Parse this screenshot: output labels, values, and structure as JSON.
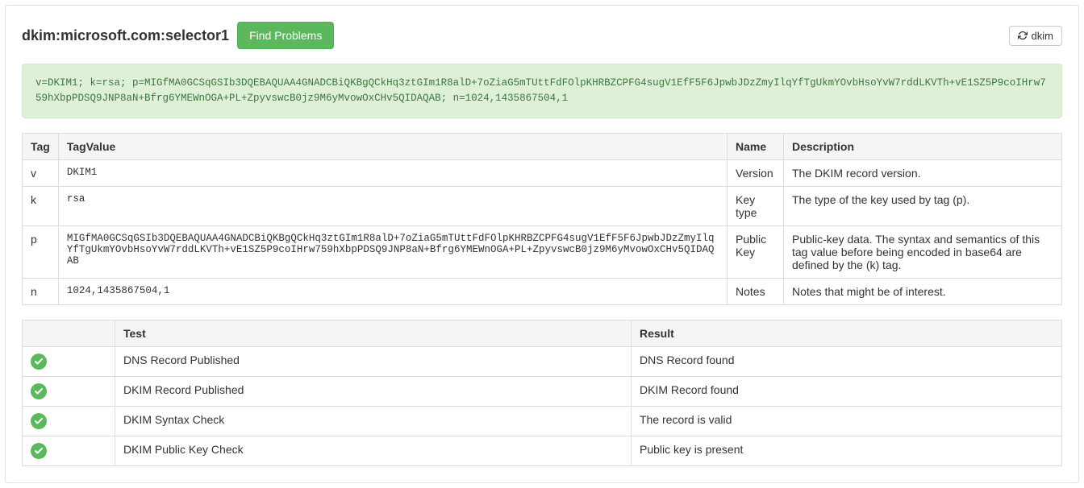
{
  "header": {
    "title": "dkim:microsoft.com:selector1",
    "find_problems_label": "Find Problems",
    "dkim_button_label": "dkim"
  },
  "record_block": "v=DKIM1; k=rsa; p=MIGfMA0GCSqGSIb3DQEBAQUAA4GNADCBiQKBgQCkHq3ztGIm1R8alD+7oZiaG5mTUttFdFOlpKHRBZCPFG4sugV1EfF5F6JpwbJDzZmyIlqYfTgUkmYOvbHsoYvW7rddLKVTh+vE1SZ5P9coIHrw759hXbpPDSQ9JNP8aN+Bfrg6YMEWnOGA+PL+ZpyvswcB0jz9M6yMvowOxCHv5QIDAQAB; n=1024,1435867504,1",
  "tags_table": {
    "headers": {
      "tag": "Tag",
      "tagvalue": "TagValue",
      "name": "Name",
      "description": "Description"
    },
    "rows": [
      {
        "tag": "v",
        "value": "DKIM1",
        "name": "Version",
        "description": "The DKIM record version."
      },
      {
        "tag": "k",
        "value": "rsa",
        "name": "Key type",
        "description": "The type of the key used by tag (p)."
      },
      {
        "tag": "p",
        "value": "MIGfMA0GCSqGSIb3DQEBAQUAA4GNADCBiQKBgQCkHq3ztGIm1R8alD+7oZiaG5mTUttFdFOlpKHRBZCPFG4sugV1EfF5F6JpwbJDzZmyIlqYfTgUkmYOvbHsoYvW7rddLKVTh+vE1SZ5P9coIHrw759hXbpPDSQ9JNP8aN+Bfrg6YMEWnOGA+PL+ZpyvswcB0jz9M6yMvowOxCHv5QIDAQAB",
        "name": "Public Key",
        "description": "Public-key data. The syntax and semantics of this tag value before being encoded in base64 are defined by the (k) tag."
      },
      {
        "tag": "n",
        "value": "1024,1435867504,1",
        "name": "Notes",
        "description": "Notes that might be of interest."
      }
    ]
  },
  "tests_table": {
    "headers": {
      "icon": "",
      "test": "Test",
      "result": "Result"
    },
    "rows": [
      {
        "status": "ok",
        "test": "DNS Record Published",
        "result": "DNS Record found"
      },
      {
        "status": "ok",
        "test": "DKIM Record Published",
        "result": "DKIM Record found"
      },
      {
        "status": "ok",
        "test": "DKIM Syntax Check",
        "result": "The record is valid"
      },
      {
        "status": "ok",
        "test": "DKIM Public Key Check",
        "result": "Public key is present"
      }
    ]
  }
}
